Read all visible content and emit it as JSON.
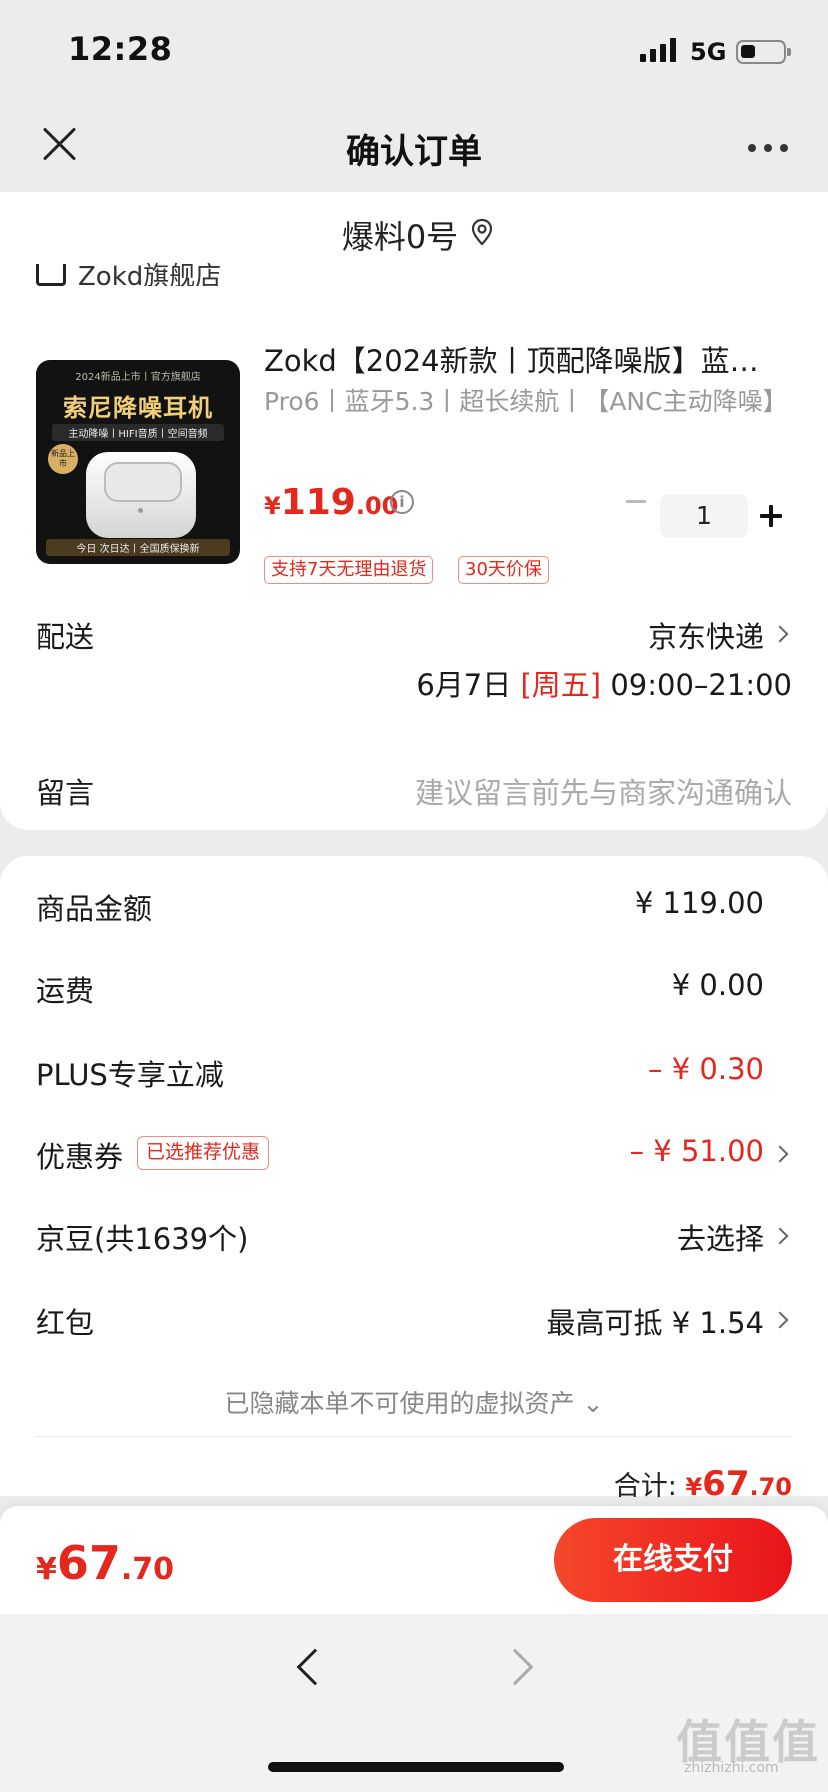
{
  "status_bar": {
    "time": "12:28",
    "network": "5G"
  },
  "nav": {
    "title": "确认订单"
  },
  "address": {
    "text": "爆料0号"
  },
  "store": {
    "name": "Zokd旗舰店"
  },
  "product": {
    "title": "Zokd【2024新款丨顶配降噪版】蓝…",
    "spec": "Pro6丨蓝牙5.3丨超长续航丨【ANC主动降噪】",
    "price_currency": "¥",
    "price_int": "119",
    "price_dec": ".00",
    "quantity": "1",
    "tags": [
      "支持7天无理由退货",
      "30天价保"
    ],
    "image": {
      "top_text": "2024新品上市丨官方旗舰店",
      "title": "索尼降噪耳机",
      "subtitle": "主动降噪丨HIFI音质丨空间音频",
      "badge": "新品上市",
      "footer": "今日 次日达丨全国质保换新"
    }
  },
  "delivery": {
    "label": "配送",
    "carrier": "京东快递",
    "date": "6月7日",
    "weekday": "[周五]",
    "window": "09:00–21:00"
  },
  "message": {
    "label": "留言",
    "placeholder": "建议留言前先与商家沟通确认"
  },
  "amounts": {
    "goods_label": "商品金额",
    "goods_value": "¥ 119.00",
    "shipping_label": "运费",
    "shipping_value": "¥ 0.00",
    "plus_label": "PLUS专享立减",
    "plus_value": "– ¥ 0.30",
    "coupon_label": "优惠券",
    "coupon_badge": "已选推荐优惠",
    "coupon_value": "– ¥ 51.00",
    "beans_label": "京豆(共1639个)",
    "beans_value": "去选择",
    "redpacket_label": "红包",
    "redpacket_value": "最高可抵 ¥ 1.54",
    "hidden_note": "已隐藏本单不可使用的虚拟资产 ⌄",
    "total_label": "合计:",
    "total_currency": "¥",
    "total_int": "67",
    "total_dec": ".70"
  },
  "pay": {
    "currency": "¥",
    "int": "67",
    "dec": ".70",
    "button": "在线支付"
  },
  "watermark": {
    "main": "值值值",
    "sub": "zhizhizhi.com"
  }
}
